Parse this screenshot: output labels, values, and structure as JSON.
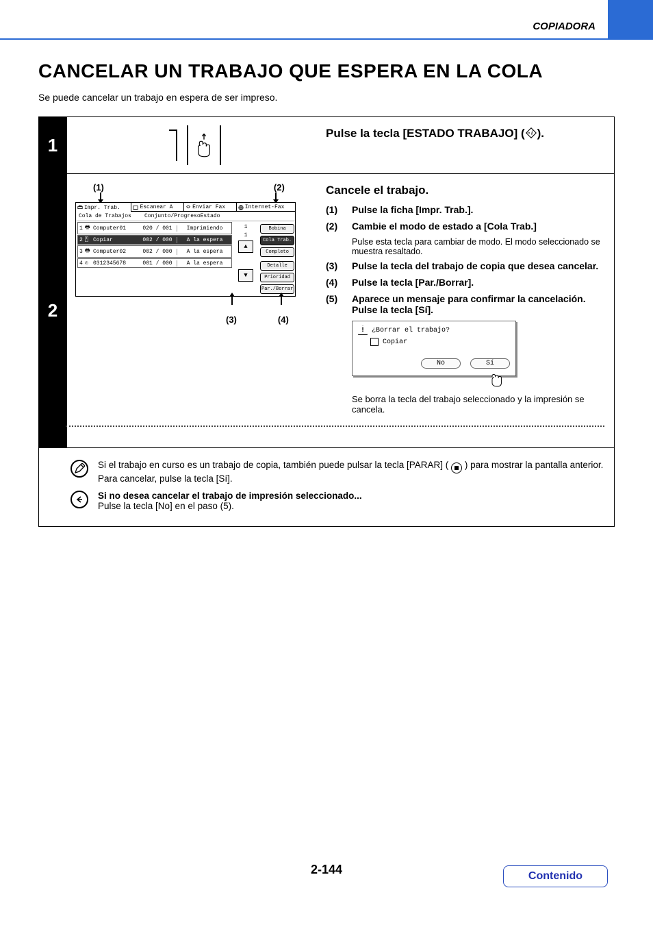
{
  "header": {
    "section_label": "COPIADORA"
  },
  "title": "CANCELAR UN TRABAJO QUE ESPERA EN LA COLA",
  "intro": "Se puede cancelar un trabajo en espera de ser impreso.",
  "step1": {
    "number": "1",
    "heading_prefix": "Pulse la tecla [ESTADO TRABAJO] (",
    "heading_suffix": ")."
  },
  "step2": {
    "number": "2",
    "heading": "Cancele el trabajo.",
    "callouts": {
      "c1": "(1)",
      "c2": "(2)",
      "c3": "(3)",
      "c4": "(4)"
    },
    "lcd": {
      "tabs": {
        "t1": "Impr. Trab.",
        "t2": "Escanear A",
        "t3": "Enviar Fax",
        "t4": "Internet-Fax"
      },
      "columns": {
        "c1": "Cola de Trabajos",
        "c2": "Conjunto/Progreso",
        "c3": "Estado"
      },
      "rows": [
        {
          "ix": "1",
          "name": "Computer01",
          "prog": "020 / 001",
          "status": "Imprimiendo"
        },
        {
          "ix": "2",
          "name": "Copiar",
          "prog": "002 / 000",
          "status": "A la espera"
        },
        {
          "ix": "3",
          "name": "Computer02",
          "prog": "002 / 000",
          "status": "A la espera"
        },
        {
          "ix": "4",
          "name": "0312345678",
          "prog": "001 / 000",
          "status": "A la espera"
        }
      ],
      "pager": {
        "page": "1",
        "total": "1"
      },
      "side": {
        "bobina": "Bobina",
        "cola": "Cola Trab.",
        "completo": "Completo",
        "detalle": "Detalle",
        "prioridad": "Prioridad",
        "parar": "Par./Borrar"
      }
    },
    "items": {
      "i1": "(1)",
      "t1": "Pulse la ficha [Impr. Trab.].",
      "i2": "(2)",
      "t2": "Cambie el modo de estado a [Cola Trab.]",
      "n2": "Pulse esta tecla para cambiar de modo. El modo seleccionado se muestra resaltado.",
      "i3": "(3)",
      "t3": "Pulse la tecla del trabajo de copia que desea cancelar.",
      "i4": "(4)",
      "t4": "Pulse la tecla [Par./Borrar].",
      "i5": "(5)",
      "t5": "Aparece un mensaje para confirmar la cancelación. Pulse la tecla [Sí]."
    },
    "dialog": {
      "question": "¿Borrar el trabajo?",
      "item": "Copiar",
      "no": "No",
      "si": "Sí"
    },
    "after_dialog": "Se borra la tecla del trabajo seleccionado y la impresión se cancela."
  },
  "notes": {
    "n1a": "Si el trabajo en curso es un trabajo de copia, también puede pulsar la tecla [PARAR] (",
    "n1b": ") para mostrar la pantalla anterior.",
    "n1c": "Para cancelar, pulse la tecla [Sí].",
    "n2a": "Si no desea cancelar el trabajo de impresión seleccionado...",
    "n2b": "Pulse la tecla [No] en el paso (5)."
  },
  "footer": {
    "page": "2-144",
    "contents": "Contenido"
  }
}
